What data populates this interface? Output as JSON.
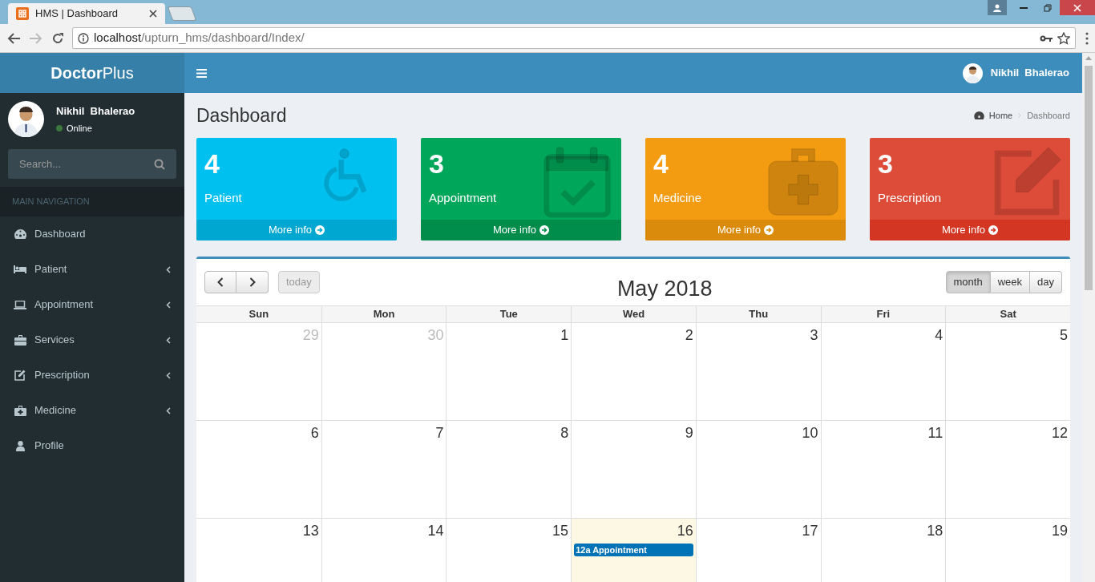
{
  "browser": {
    "tab_title": "HMS | Dashboard",
    "url_host": "localhost",
    "url_path": "/upturn_hms/dashboard/Index/"
  },
  "brand": "**Doctor**Plus",
  "sidebar": {
    "user": {
      "name": "Nikhil  Bhalerao",
      "status": "Online",
      "online": true
    },
    "search": {
      "placeholder": "Search..."
    },
    "nav_header": "MAIN NAVIGATION",
    "items": [
      {
        "label": "Dashboard",
        "submenu": false
      },
      {
        "label": "Patient",
        "submenu": true
      },
      {
        "label": "Appointment",
        "submenu": true
      },
      {
        "label": "Services",
        "submenu": true
      },
      {
        "label": "Prescription",
        "submenu": true
      },
      {
        "label": "Medicine",
        "submenu": true
      },
      {
        "label": "Profile",
        "submenu": false
      }
    ]
  },
  "navbar": {
    "user_name": "Nikhil  Bhalerao"
  },
  "page": {
    "title": "Dashboard",
    "breadcrumb": [
      "Home",
      "Dashboard"
    ]
  },
  "stats": [
    {
      "count": "4",
      "label": "Patient",
      "link": "More info",
      "color": "#00c0ef"
    },
    {
      "count": "3",
      "label": "Appointment",
      "link": "More info",
      "color": "#00a65a"
    },
    {
      "count": "4",
      "label": "Medicine",
      "link": "More info",
      "color": "#f39c12"
    },
    {
      "count": "3",
      "label": "Prescription",
      "link": "More info",
      "color": "#dd4b39"
    }
  ],
  "calendar": {
    "title": "May 2018",
    "today_label": "today",
    "today_disabled": true,
    "views": [
      {
        "label": "month",
        "selected": true
      },
      {
        "label": "week",
        "selected": false
      },
      {
        "label": "day",
        "selected": false
      }
    ],
    "weekdays": [
      "Sun",
      "Mon",
      "Tue",
      "Wed",
      "Thu",
      "Fri",
      "Sat"
    ],
    "weeks": [
      [
        {
          "day": "29",
          "other_month": true,
          "today": false
        },
        {
          "day": "30",
          "other_month": true,
          "today": false
        },
        {
          "day": "1",
          "other_month": false,
          "today": false
        },
        {
          "day": "2",
          "other_month": false,
          "today": false
        },
        {
          "day": "3",
          "other_month": false,
          "today": false
        },
        {
          "day": "4",
          "other_month": false,
          "today": false
        },
        {
          "day": "5",
          "other_month": false,
          "today": false
        }
      ],
      [
        {
          "day": "6",
          "other_month": false,
          "today": false
        },
        {
          "day": "7",
          "other_month": false,
          "today": false
        },
        {
          "day": "8",
          "other_month": false,
          "today": false
        },
        {
          "day": "9",
          "other_month": false,
          "today": false
        },
        {
          "day": "10",
          "other_month": false,
          "today": false
        },
        {
          "day": "11",
          "other_month": false,
          "today": false
        },
        {
          "day": "12",
          "other_month": false,
          "today": false
        }
      ],
      [
        {
          "day": "13",
          "other_month": false,
          "today": false
        },
        {
          "day": "14",
          "other_month": false,
          "today": false
        },
        {
          "day": "15",
          "other_month": false,
          "today": false
        },
        {
          "day": "16",
          "other_month": false,
          "today": true,
          "events": [
            "12a Appointment"
          ]
        },
        {
          "day": "17",
          "other_month": false,
          "today": false
        },
        {
          "day": "18",
          "other_month": false,
          "today": false
        },
        {
          "day": "19",
          "other_month": false,
          "today": false
        }
      ]
    ]
  }
}
